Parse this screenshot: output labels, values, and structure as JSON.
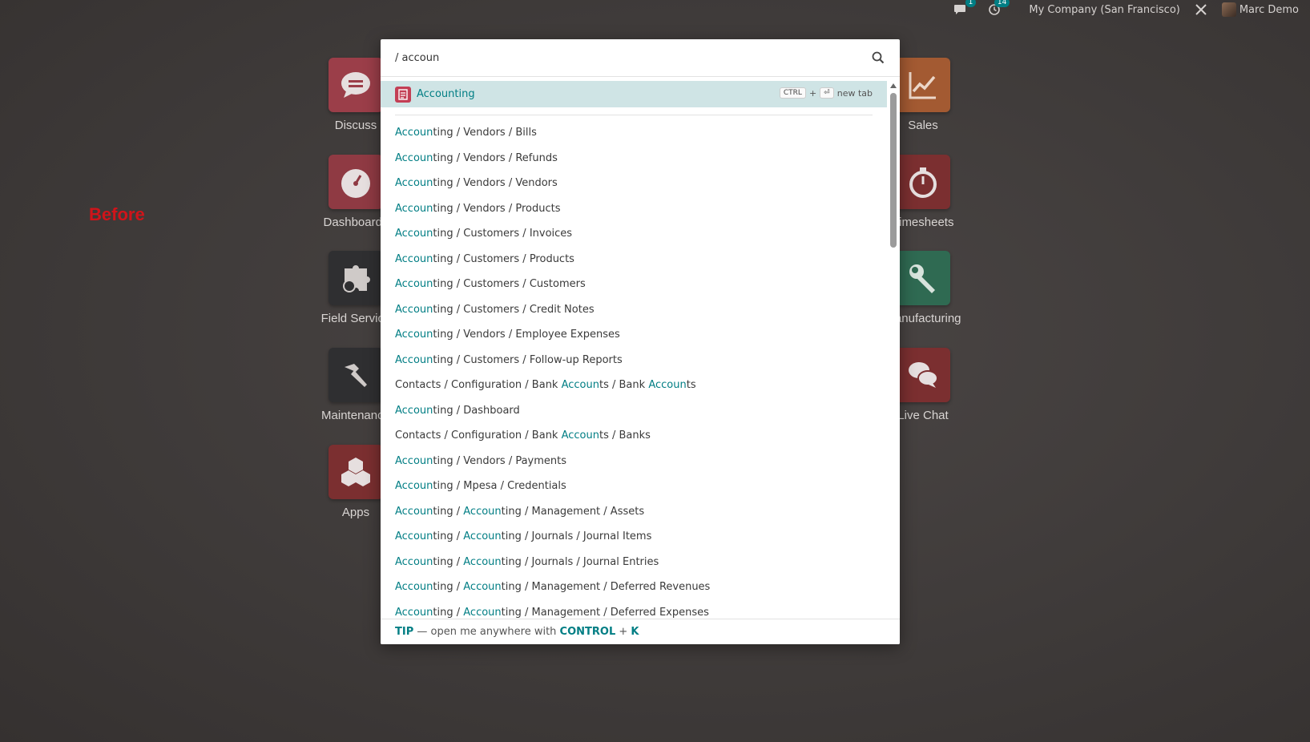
{
  "topbar": {
    "messages_count": "1",
    "activities_count": "14",
    "company": "My Company (San Francisco)",
    "user": "Marc Demo"
  },
  "annotation": "Before",
  "apps_left": [
    {
      "label": "Discuss",
      "color": "#9b3e49",
      "icon": "chat-icon"
    },
    {
      "label": "Dashboards",
      "color": "#8f3a43",
      "icon": "speedometer-icon"
    },
    {
      "label": "Field Service",
      "color": "#2f2f31",
      "icon": "puzzle-icon"
    },
    {
      "label": "Maintenance",
      "color": "#2f2f31",
      "icon": "hammer-icon"
    },
    {
      "label": "Apps",
      "color": "#7b2f30",
      "icon": "cubes-icon"
    }
  ],
  "apps_right": [
    {
      "label": "Sales",
      "color": "#a35a32",
      "icon": "chart-up-icon"
    },
    {
      "label": "Timesheets",
      "color": "#7b2f30",
      "icon": "stopwatch-icon"
    },
    {
      "label": "Manufacturing",
      "color": "#2f6a52",
      "icon": "wrench-icon"
    },
    {
      "label": "Live Chat",
      "color": "#7b2f30",
      "icon": "chat-bubbles-icon"
    }
  ],
  "palette": {
    "query": "/ accoun",
    "first": {
      "hl": "Accoun",
      "rest": "ting"
    },
    "shortcut": {
      "key1": "CTRL",
      "plus": "+",
      "key2": "⏎",
      "label": "new tab"
    },
    "results": [
      [
        [
          "Accoun",
          1
        ],
        [
          "ting / Vendors / Bills",
          0
        ]
      ],
      [
        [
          "Accoun",
          1
        ],
        [
          "ting / Vendors / Refunds",
          0
        ]
      ],
      [
        [
          "Accoun",
          1
        ],
        [
          "ting / Vendors / Vendors",
          0
        ]
      ],
      [
        [
          "Accoun",
          1
        ],
        [
          "ting / Vendors / Products",
          0
        ]
      ],
      [
        [
          "Accoun",
          1
        ],
        [
          "ting / Customers / Invoices",
          0
        ]
      ],
      [
        [
          "Accoun",
          1
        ],
        [
          "ting / Customers / Products",
          0
        ]
      ],
      [
        [
          "Accoun",
          1
        ],
        [
          "ting / Customers / Customers",
          0
        ]
      ],
      [
        [
          "Accoun",
          1
        ],
        [
          "ting / Customers / Credit Notes",
          0
        ]
      ],
      [
        [
          "Accoun",
          1
        ],
        [
          "ting / Vendors / Employee Expenses",
          0
        ]
      ],
      [
        [
          "Accoun",
          1
        ],
        [
          "ting / Customers / Follow-up Reports",
          0
        ]
      ],
      [
        [
          "Contacts / Configuration / Bank ",
          0
        ],
        [
          "Accoun",
          1
        ],
        [
          "ts / Bank ",
          0
        ],
        [
          "Accoun",
          1
        ],
        [
          "ts",
          0
        ]
      ],
      [
        [
          "Accoun",
          1
        ],
        [
          "ting / Dashboard",
          0
        ]
      ],
      [
        [
          "Contacts / Configuration / Bank ",
          0
        ],
        [
          "Accoun",
          1
        ],
        [
          "ts / Banks",
          0
        ]
      ],
      [
        [
          "Accoun",
          1
        ],
        [
          "ting / Vendors / Payments",
          0
        ]
      ],
      [
        [
          "Accoun",
          1
        ],
        [
          "ting / Mpesa / Credentials",
          0
        ]
      ],
      [
        [
          "Accoun",
          1
        ],
        [
          "ting / ",
          0
        ],
        [
          "Accoun",
          1
        ],
        [
          "ting / Management / Assets",
          0
        ]
      ],
      [
        [
          "Accoun",
          1
        ],
        [
          "ting / ",
          0
        ],
        [
          "Accoun",
          1
        ],
        [
          "ting / Journals / Journal Items",
          0
        ]
      ],
      [
        [
          "Accoun",
          1
        ],
        [
          "ting / ",
          0
        ],
        [
          "Accoun",
          1
        ],
        [
          "ting / Journals / Journal Entries",
          0
        ]
      ],
      [
        [
          "Accoun",
          1
        ],
        [
          "ting / ",
          0
        ],
        [
          "Accoun",
          1
        ],
        [
          "ting / Management / Deferred Revenues",
          0
        ]
      ],
      [
        [
          "Accoun",
          1
        ],
        [
          "ting / ",
          0
        ],
        [
          "Accoun",
          1
        ],
        [
          "ting / Management / Deferred Expenses",
          0
        ]
      ]
    ],
    "footer": {
      "tip": "TIP",
      "text": " — open me anywhere with ",
      "key1": "CONTROL",
      "plus": " + ",
      "key2": "K"
    }
  }
}
